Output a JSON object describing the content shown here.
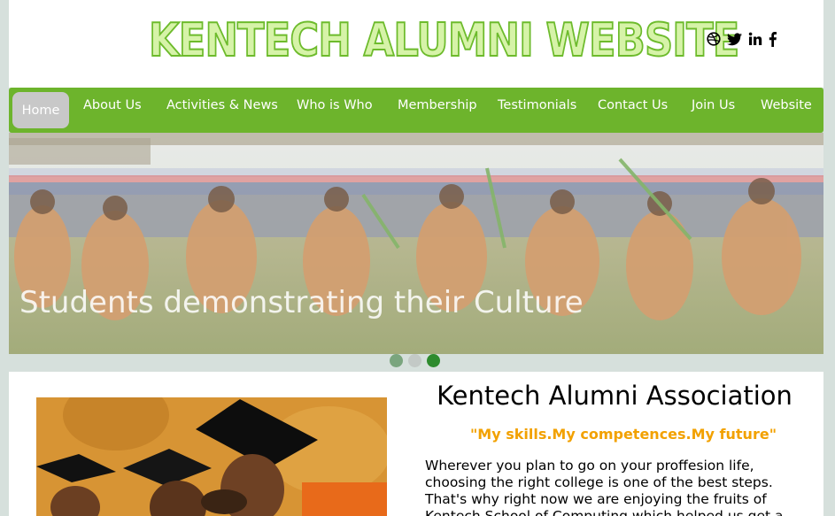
{
  "header": {
    "logo_text": "KENTECH ALUMNI WEBSITE",
    "social_icons": [
      "dribbble-icon",
      "twitter-icon",
      "linkedin-icon",
      "facebook-icon"
    ]
  },
  "nav": {
    "items": [
      {
        "label": "Home",
        "active": true
      },
      {
        "label": "About Us"
      },
      {
        "label": "Activities & News"
      },
      {
        "label": "Who is Who"
      },
      {
        "label": "Membership"
      },
      {
        "label": "Testimonials"
      },
      {
        "label": "Contact Us"
      },
      {
        "label": "Join Us"
      },
      {
        "label": "Website"
      }
    ]
  },
  "slider": {
    "caption": "Students demonstrating their Culture",
    "slide_count": 3,
    "active_slide": 3
  },
  "main": {
    "title": "Kentech Alumni Association",
    "motto": "\"My skills.My competences.My future\"",
    "intro": "Wherever you plan to go on your proffesion life, choosing the right college is one of the best steps. That's why right now we are enjoying the fruits of Kentech School of Computing which helped us get a"
  },
  "colors": {
    "nav_green": "#6db42c",
    "motto_orange": "#f2a100",
    "page_bg": "#d6e0dc",
    "dot_active": "#2e8b2e",
    "dot_first": "#7aa57e",
    "dot_inactive": "#c3c9c6"
  }
}
